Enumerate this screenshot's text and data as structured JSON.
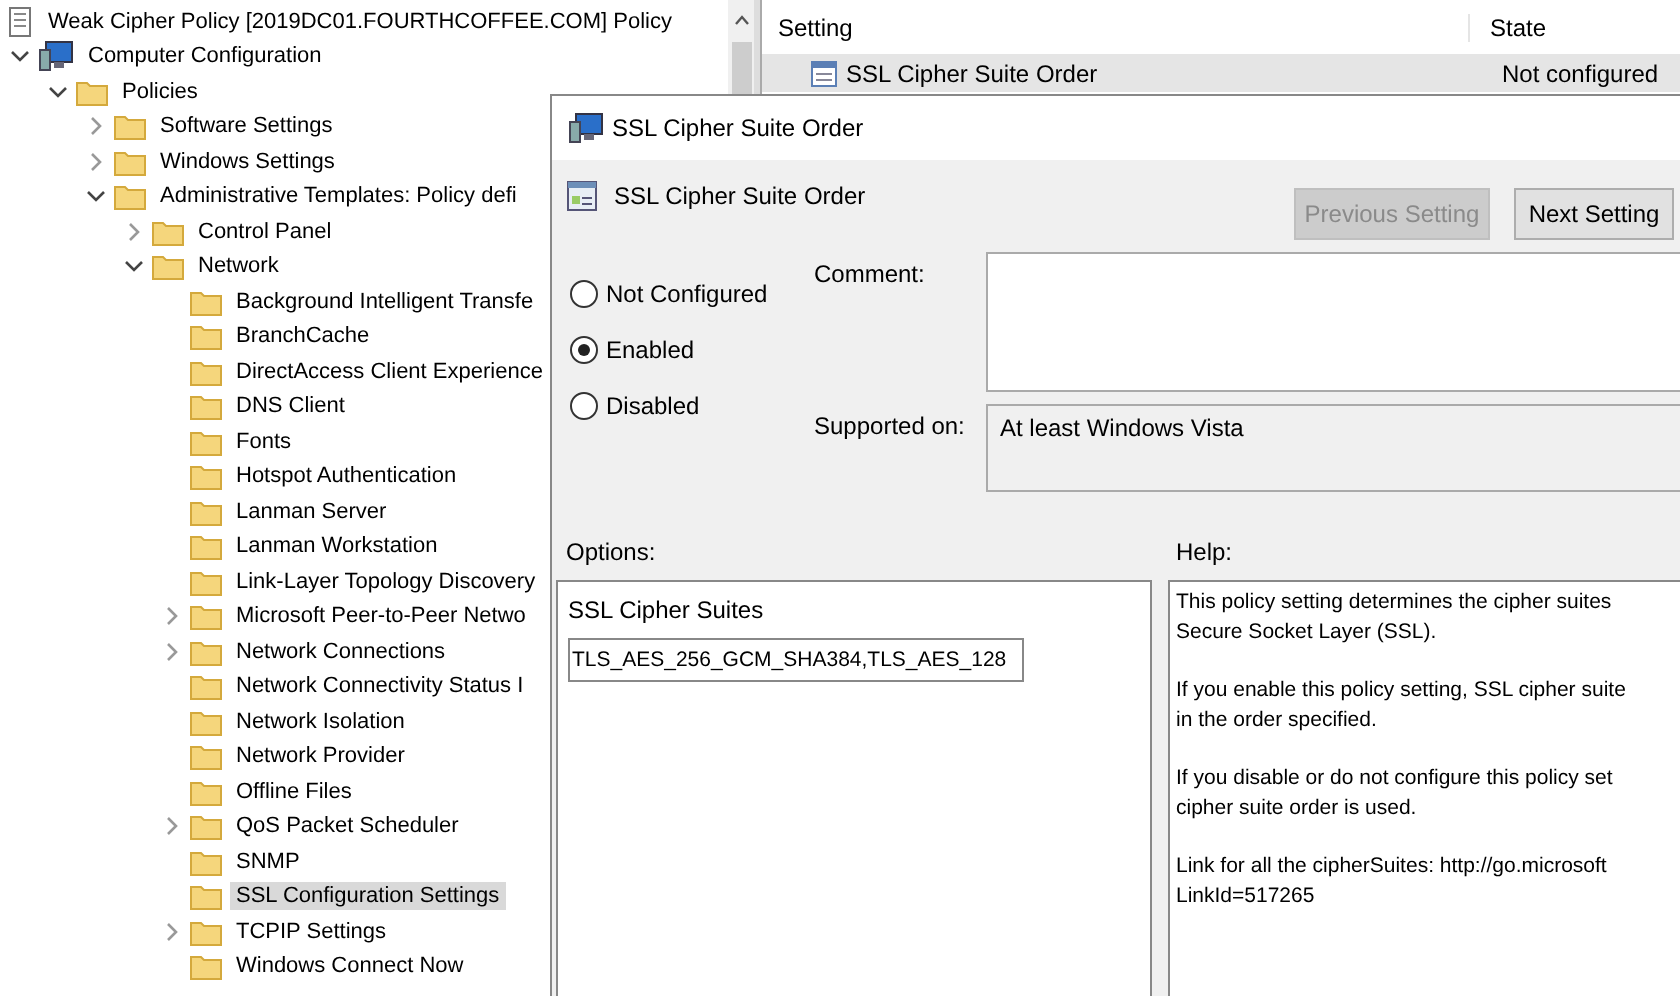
{
  "tree": {
    "title": "Weak Cipher Policy [2019DC01.FOURTHCOFFEE.COM] Policy",
    "items": [
      {
        "label": "Computer Configuration",
        "kind": "computer",
        "expanded": true,
        "selected": false,
        "children": [
          {
            "label": "Policies",
            "kind": "folder",
            "expanded": true,
            "selected": false,
            "children": [
              {
                "label": "Software Settings",
                "kind": "folder",
                "expanded": false,
                "selected": false
              },
              {
                "label": "Windows Settings",
                "kind": "folder",
                "expanded": false,
                "selected": false
              },
              {
                "label": "Administrative Templates: Policy defi",
                "kind": "folder",
                "expanded": true,
                "selected": false,
                "children": [
                  {
                    "label": "Control Panel",
                    "kind": "folder",
                    "expanded": false,
                    "selected": false
                  },
                  {
                    "label": "Network",
                    "kind": "folder",
                    "expanded": true,
                    "selected": false,
                    "children": [
                      {
                        "label": "Background Intelligent Transfe",
                        "kind": "folder",
                        "selected": false
                      },
                      {
                        "label": "BranchCache",
                        "kind": "folder",
                        "selected": false
                      },
                      {
                        "label": "DirectAccess Client Experience",
                        "kind": "folder",
                        "selected": false
                      },
                      {
                        "label": "DNS Client",
                        "kind": "folder",
                        "selected": false
                      },
                      {
                        "label": "Fonts",
                        "kind": "folder",
                        "selected": false
                      },
                      {
                        "label": "Hotspot Authentication",
                        "kind": "folder",
                        "selected": false
                      },
                      {
                        "label": "Lanman Server",
                        "kind": "folder",
                        "selected": false
                      },
                      {
                        "label": "Lanman Workstation",
                        "kind": "folder",
                        "selected": false
                      },
                      {
                        "label": "Link-Layer Topology Discovery",
                        "kind": "folder",
                        "selected": false
                      },
                      {
                        "label": "Microsoft Peer-to-Peer Netwo",
                        "kind": "folder",
                        "expanded": false,
                        "selected": false
                      },
                      {
                        "label": "Network Connections",
                        "kind": "folder",
                        "expanded": false,
                        "selected": false
                      },
                      {
                        "label": "Network Connectivity Status I",
                        "kind": "folder",
                        "selected": false
                      },
                      {
                        "label": "Network Isolation",
                        "kind": "folder",
                        "selected": false
                      },
                      {
                        "label": "Network Provider",
                        "kind": "folder",
                        "selected": false
                      },
                      {
                        "label": "Offline Files",
                        "kind": "folder",
                        "selected": false
                      },
                      {
                        "label": "QoS Packet Scheduler",
                        "kind": "folder",
                        "expanded": false,
                        "selected": false
                      },
                      {
                        "label": "SNMP",
                        "kind": "folder",
                        "selected": false
                      },
                      {
                        "label": "SSL Configuration Settings",
                        "kind": "folder",
                        "selected": true
                      },
                      {
                        "label": "TCPIP Settings",
                        "kind": "folder",
                        "expanded": false,
                        "selected": false
                      },
                      {
                        "label": "Windows Connect Now",
                        "kind": "folder",
                        "selected": false
                      }
                    ]
                  }
                ]
              }
            ]
          }
        ]
      }
    ]
  },
  "list": {
    "columns": [
      "Setting",
      "State"
    ],
    "rows": [
      {
        "setting": "SSL Cipher Suite Order",
        "state": "Not configured",
        "selected": true
      }
    ]
  },
  "dialog": {
    "title": "SSL Cipher Suite Order",
    "heading": "SSL Cipher Suite Order",
    "buttons": [
      {
        "label": "Previous Setting",
        "disabled": true
      },
      {
        "label": "Next Setting",
        "disabled": false
      }
    ],
    "states": [
      {
        "label": "Not Configured",
        "selected": false
      },
      {
        "label": "Enabled",
        "selected": true
      },
      {
        "label": "Disabled",
        "selected": false
      }
    ],
    "comment_label": "Comment:",
    "supported_label": "Supported on:",
    "supported_value": "At least Windows Vista",
    "options_label": "Options:",
    "help_label": "Help:",
    "option_field": {
      "label": "SSL Cipher Suites",
      "value": "TLS_AES_256_GCM_SHA384,TLS_AES_128"
    },
    "help": [
      [
        "This policy setting determines the cipher suites",
        "Secure Socket Layer (SSL)."
      ],
      [
        "If you enable this policy setting, SSL cipher suite",
        "in the order specified."
      ],
      [
        "If you disable or do not configure this policy set",
        "cipher suite order is used."
      ],
      [
        "Link for all the cipherSuites: http://go.microsoft",
        "LinkId=517265"
      ]
    ]
  }
}
